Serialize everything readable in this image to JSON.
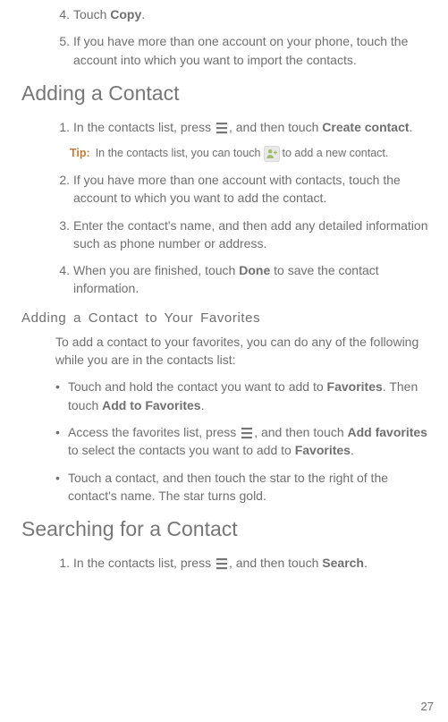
{
  "list_a": {
    "item4": {
      "num": "4.",
      "pre": "Touch ",
      "b1": "Copy",
      "post": "."
    },
    "item5": {
      "num": "5.",
      "text": "If you have more than one account on your phone, touch the account into which you want to import the contacts."
    }
  },
  "heading_adding": "Adding a Contact",
  "add_steps": {
    "s1": {
      "num": "1.",
      "pre": "In the contacts list, press  ",
      "mid": ", and then touch ",
      "b1": "Create contact",
      "post": "."
    },
    "tip": {
      "label": "Tip:",
      "pre": " In the contacts list, you can touch ",
      "post": " to add a new contact."
    },
    "s2": {
      "num": "2.",
      "text": "If you have more than one account with contacts, touch the account to which you want to add the contact."
    },
    "s3": {
      "num": "3.",
      "text": "Enter the contact's name, and then add any detailed information such as phone number or address."
    },
    "s4": {
      "num": "4.",
      "pre": "When you are finished, touch ",
      "b1": "Done",
      "post": " to save the contact information."
    }
  },
  "heading_fav": "Adding a Contact to Your Favorites",
  "fav_intro": "To add a contact to your favorites, you can do any of the following while you are in the contacts list:",
  "fav_bullets": {
    "bullet": "•",
    "b1": {
      "pre": "Touch and hold the contact you want to add to ",
      "bold1": "Favorites",
      "mid": ". Then touch ",
      "bold2": "Add to Favorites",
      "post": "."
    },
    "b2": {
      "pre": "Access the favorites list, press  ",
      "mid": ", and then touch ",
      "bold1": "Add favorites",
      "mid2": " to select the contacts you want to add to ",
      "bold2": "Favorites",
      "post": "."
    },
    "b3": {
      "text": "Touch a contact, and then touch the star to the right of the contact's name. The star turns gold."
    }
  },
  "heading_search": "Searching for a Contact",
  "search_steps": {
    "s1": {
      "num": "1.",
      "pre": "In the contacts list, press  ",
      "mid": ", and then touch ",
      "b1": "Search",
      "post": "."
    }
  },
  "page_number": "27"
}
